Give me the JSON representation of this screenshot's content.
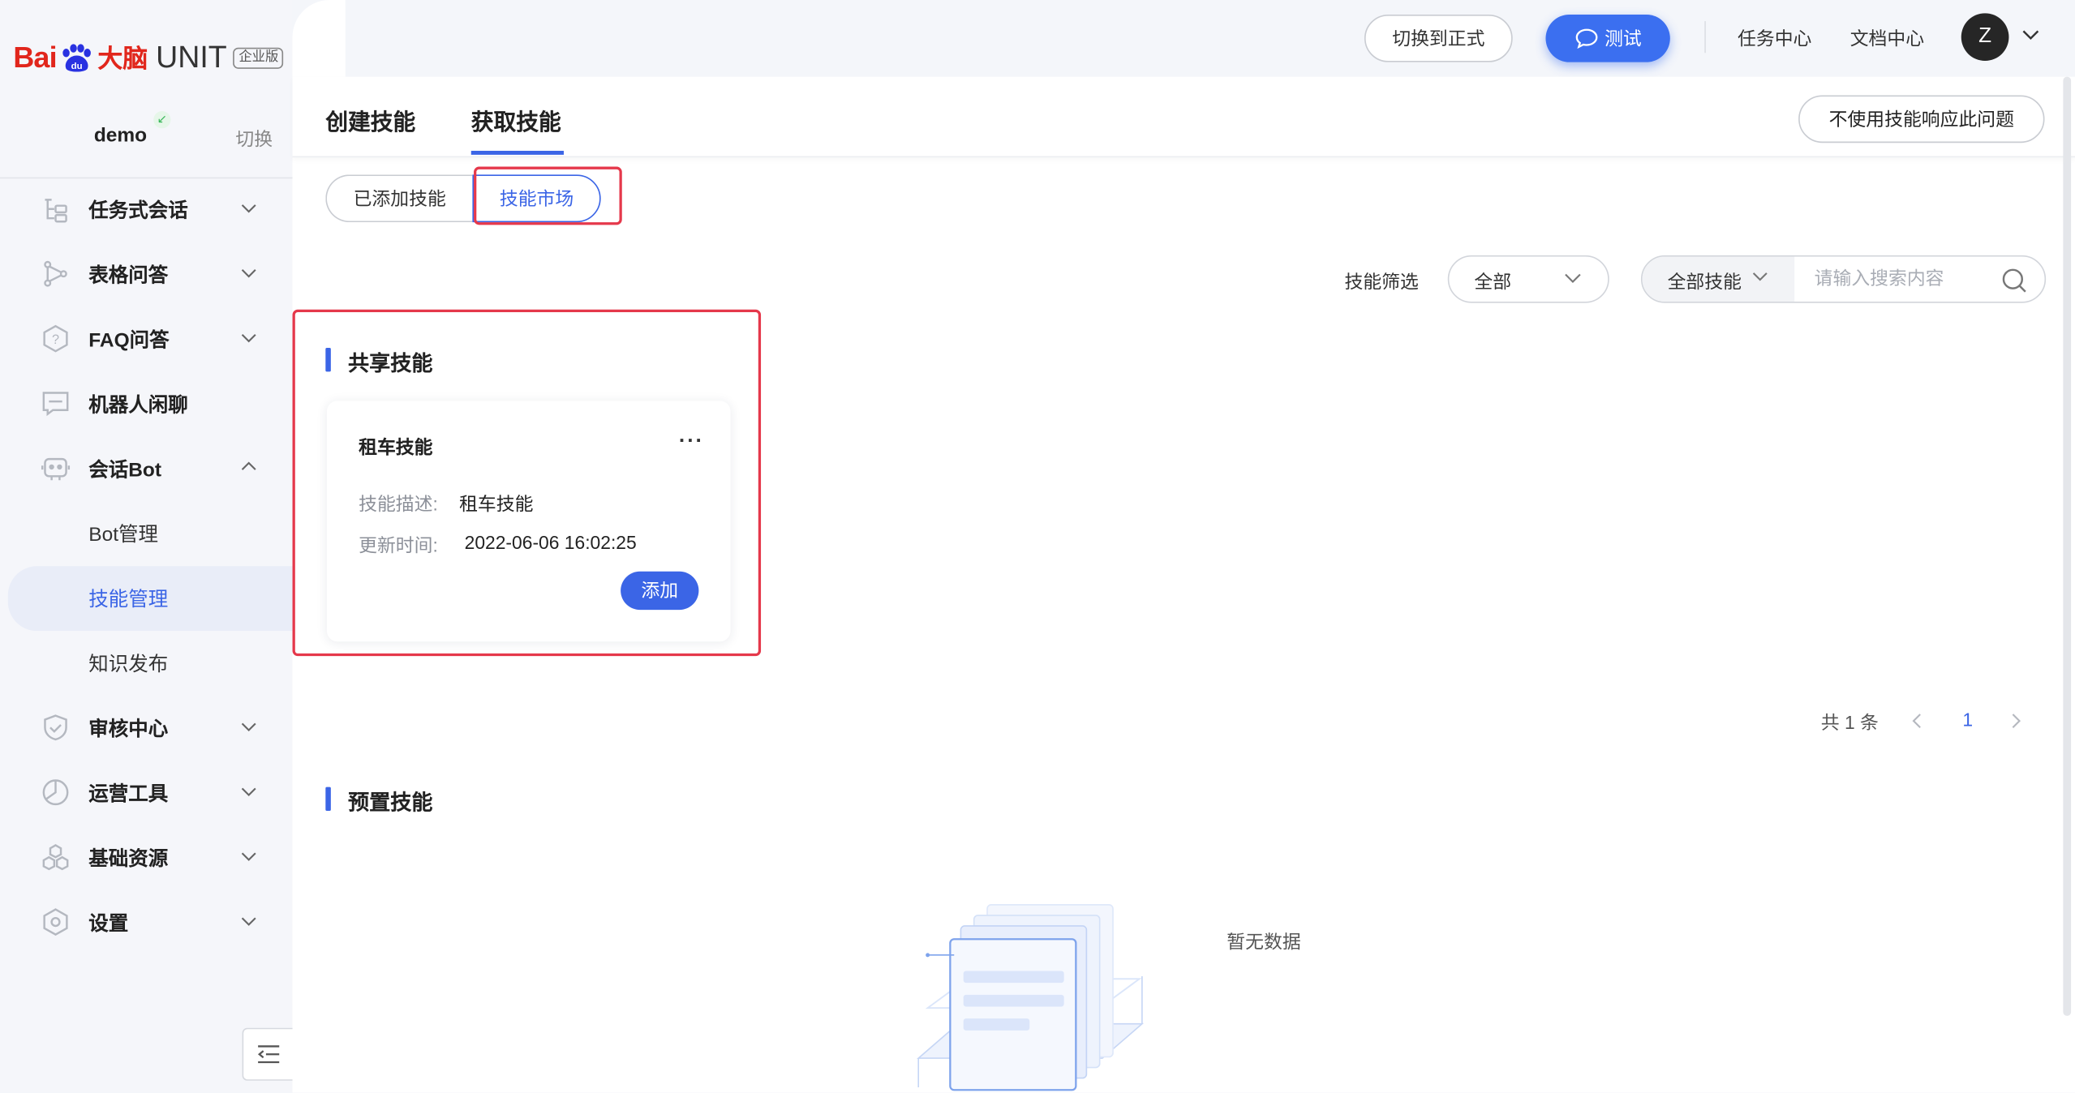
{
  "logo": {
    "brand": "Bai",
    "brand2": "大脑",
    "product": "UNIT",
    "edition": "企业版"
  },
  "workspace": {
    "name": "demo",
    "switch_label": "切换"
  },
  "sidebar": {
    "items": [
      {
        "label": "任务式会话",
        "icon": "task-dialog-icon",
        "expandable": true
      },
      {
        "label": "表格问答",
        "icon": "table-qa-icon",
        "expandable": true
      },
      {
        "label": "FAQ问答",
        "icon": "faq-icon",
        "expandable": true
      },
      {
        "label": "机器人闲聊",
        "icon": "chat-icon",
        "expandable": false
      },
      {
        "label": "会话Bot",
        "icon": "bot-icon",
        "expandable": true,
        "expanded": true
      },
      {
        "label": "Bot管理",
        "sub": true
      },
      {
        "label": "技能管理",
        "sub": true,
        "active": true
      },
      {
        "label": "知识发布",
        "sub": true
      },
      {
        "label": "审核中心",
        "icon": "shield-icon",
        "expandable": true
      },
      {
        "label": "运营工具",
        "icon": "tools-icon",
        "expandable": true
      },
      {
        "label": "基础资源",
        "icon": "resources-icon",
        "expandable": true
      },
      {
        "label": "设置",
        "icon": "settings-icon",
        "expandable": true
      }
    ]
  },
  "header": {
    "switch_formal_label": "切换到正式",
    "test_label": "测试",
    "task_center_label": "任务中心",
    "doc_center_label": "文档中心",
    "avatar_initial": "Z"
  },
  "tabs": [
    {
      "label": "创建技能",
      "active": false
    },
    {
      "label": "获取技能",
      "active": true
    }
  ],
  "no_skill_button_label": "不使用技能响应此问题",
  "segments": {
    "added_label": "已添加技能",
    "market_label": "技能市场",
    "selected": "技能市场"
  },
  "filter": {
    "label": "技能筛选",
    "select_value": "全部",
    "search_type": "全部技能",
    "search_placeholder": "请输入搜索内容"
  },
  "shared_section": {
    "title": "共享技能",
    "cards": [
      {
        "title": "租车技能",
        "more": "···",
        "desc_key": "技能描述:",
        "desc_value": "租车技能",
        "time_key": "更新时间:",
        "time_value": "2022-06-06 16:02:25",
        "add_label": "添加"
      }
    ]
  },
  "pagination": {
    "total_text": "共 1 条",
    "current_page": "1"
  },
  "preset_section": {
    "title": "预置技能",
    "empty_text": "暂无数据"
  },
  "colors": {
    "primary": "#3b65e6",
    "highlight_border": "#e5384b",
    "brand_red": "#e1261c"
  }
}
